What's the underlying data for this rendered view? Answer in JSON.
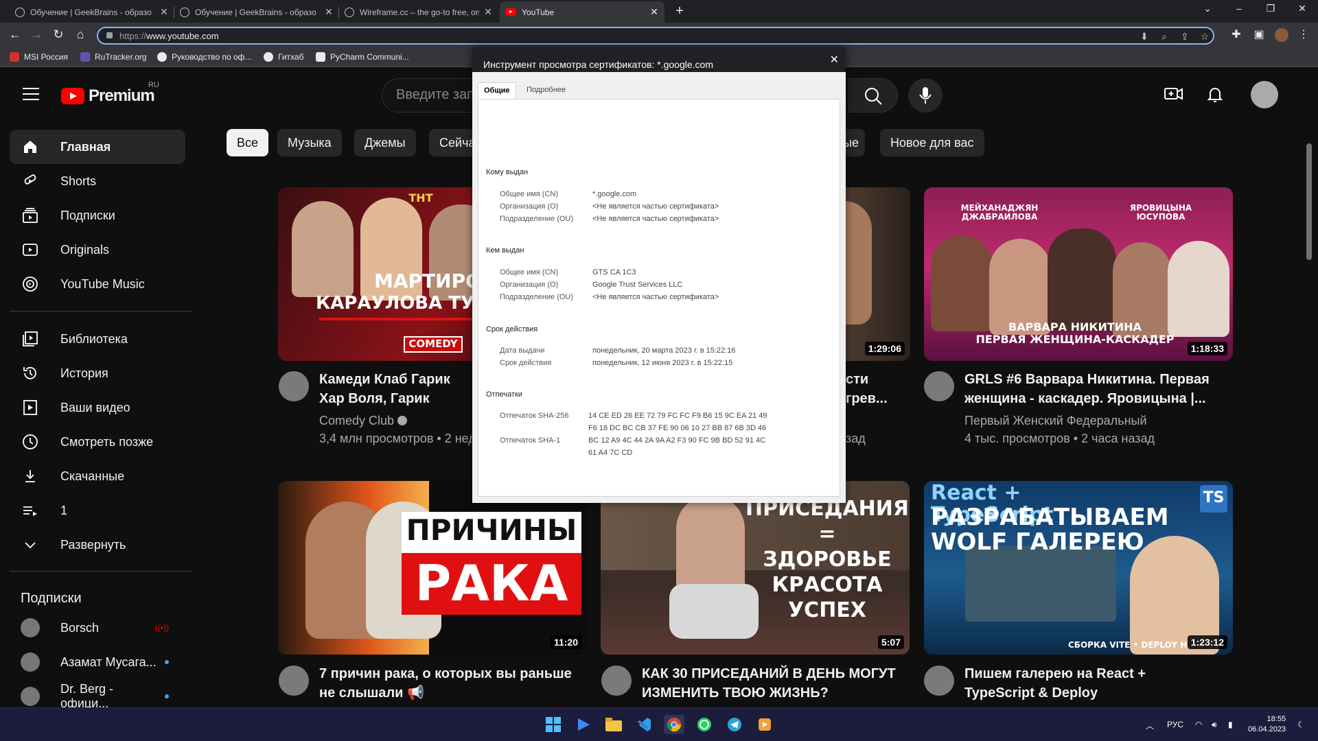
{
  "browser": {
    "tabs": [
      {
        "title": "Обучение | GeekBrains - образо"
      },
      {
        "title": "Обучение | GeekBrains - образо"
      },
      {
        "title": "Wireframe.cc – the go-to free, on"
      },
      {
        "title": "YouTube"
      }
    ],
    "url_scheme": "https://",
    "url_host": "www.youtube.com",
    "bookmarks": [
      "MSI Россия",
      "RuTracker.org",
      "Руководство по оф...",
      "Гитхаб",
      "PyCharm Communi..."
    ]
  },
  "youtube": {
    "logo_text": "Premium",
    "logo_region": "RU",
    "search_placeholder": "Введите зап",
    "chips": [
      "Все",
      "Музыка",
      "Джемы",
      "Сейча",
      "ые",
      "Новое для вас"
    ],
    "sidebar": {
      "main": [
        {
          "label": "Главная",
          "icon": "home-icon"
        },
        {
          "label": "Shorts",
          "icon": "shorts-icon"
        },
        {
          "label": "Подписки",
          "icon": "subscriptions-icon"
        },
        {
          "label": "Originals",
          "icon": "originals-icon"
        },
        {
          "label": "YouTube Music",
          "icon": "music-icon"
        }
      ],
      "library": [
        {
          "label": "Библиотека",
          "icon": "library-icon"
        },
        {
          "label": "История",
          "icon": "history-icon"
        },
        {
          "label": "Ваши видео",
          "icon": "your-videos-icon"
        },
        {
          "label": "Смотреть позже",
          "icon": "watch-later-icon"
        },
        {
          "label": "Скачанные",
          "icon": "downloads-icon"
        },
        {
          "label": "1",
          "icon": "playlist-icon"
        },
        {
          "label": "Развернуть",
          "icon": "chevron-down-icon"
        }
      ],
      "subscriptions_title": "Подписки",
      "subscriptions": [
        {
          "name": "Borsch",
          "status": "live"
        },
        {
          "name": "Азамат Мусага...",
          "status": "new"
        },
        {
          "name": "Dr. Berg - офици...",
          "status": "new"
        }
      ]
    },
    "videos": [
      {
        "title": "Камеди Клаб Гарик Хар Воля, Гарик Мартирося",
        "channel": "Comedy Club",
        "verified": true,
        "meta": "3,4 млн просмотров • 2 нед",
        "duration": "",
        "thumb_text": [
          "МАРТИРОСЯ",
          "КАРАУЛОВА ТУР",
          "COMEDY",
          "ТНТ"
        ]
      },
      {
        "title": "сти грев...",
        "channel": "",
        "meta": "зад",
        "duration": "1:29:06"
      },
      {
        "title": "GRLS #6 Варвара Никитина. Первая женщина - каскадер. Яровицына |...",
        "channel": "Первый Женский Федеральный",
        "meta": "4 тыс. просмотров • 2 часа назад",
        "duration": "1:18:33",
        "thumb_text": [
          "МЕЙХАНАДЖЯН ДЖАБРАИЛОВА",
          "ЯРОВИЦЫНА ЮСУПОВА",
          "ВАРВАРА НИКИТИНА",
          "ПЕРВАЯ ЖЕНЩИНА-КАСКАДЕР"
        ]
      },
      {
        "title": "7 причин рака, о которых вы раньше не слышали 📢",
        "duration": "11:20",
        "thumb_text": [
          "ПРИЧИНЫ",
          "РАКА"
        ]
      },
      {
        "title": "КАК 30 ПРИСЕДАНИЙ В ДЕНЬ МОГУТ ИЗМЕНИТЬ ТВОЮ ЖИЗНЬ?",
        "duration": "5:07",
        "thumb_text": [
          "ПРИСЕДАНИЯ",
          "=",
          "ЗДОРОВЬЕ",
          "КРАСОТА",
          "УСПЕХ"
        ]
      },
      {
        "title": "Пишем галерею на React + TypeScript & Deploy",
        "duration": "1:23:12",
        "thumb_text": [
          "React + TypeScript",
          "РАЗРАБАТЫВАЕМ",
          "WOLF ГАЛЕРЕЮ",
          "TS",
          "СБОРКА VITE • DEPLOY H..."
        ]
      }
    ]
  },
  "cert_dialog": {
    "title": "Инструмент просмотра сертификатов: *.google.com",
    "tabs": [
      "Общие",
      "Подробнее"
    ],
    "issued_to": {
      "heading": "Кому выдан",
      "rows": [
        {
          "label": "Общее имя (CN)",
          "value": "*.google.com"
        },
        {
          "label": "Организация (O)",
          "value": "<Не является частью сертификата>"
        },
        {
          "label": "Подразделение (OU)",
          "value": "<Не является частью сертификата>"
        }
      ]
    },
    "issued_by": {
      "heading": "Кем выдан",
      "rows": [
        {
          "label": "Общее имя (CN)",
          "value": "GTS CA 1C3"
        },
        {
          "label": "Организация (O)",
          "value": "Google Trust Services LLC"
        },
        {
          "label": "Подразделение (OU)",
          "value": "<Не является частью сертификата>"
        }
      ]
    },
    "validity": {
      "heading": "Срок действия",
      "rows": [
        {
          "label": "Дата выдачи",
          "value": "понедельник, 20 марта 2023 г. в 15:22:16"
        },
        {
          "label": "Срок действия",
          "value": "понедельник, 12 июня 2023 г. в 15:22:15"
        }
      ]
    },
    "fingerprints": {
      "heading": "Отпечатки",
      "sha256_label": "Отпечаток SHA-256",
      "sha256_l1": "14 CE ED 26 EE 72 79 FC FC F9 B6 15 9C EA 21 49",
      "sha256_l2": "F6 18 DC BC CB 37 FE 90 06 10 27 BB 87 6B 3D 46",
      "sha1_label": "Отпечаток SHA-1",
      "sha1_l1": "BC 12 A9 4C 44 2A 9A A2 F3 90 FC 9B BD 52 91 4C",
      "sha1_l2": "61 A4 7C CD"
    }
  },
  "taskbar": {
    "lang": "РУС",
    "time": "18:55",
    "date": "06.04.2023"
  },
  "colors": {
    "youtube_red": "#ff0000",
    "bg": "#0f0f0f",
    "accent_blue": "#3ea6ff"
  }
}
